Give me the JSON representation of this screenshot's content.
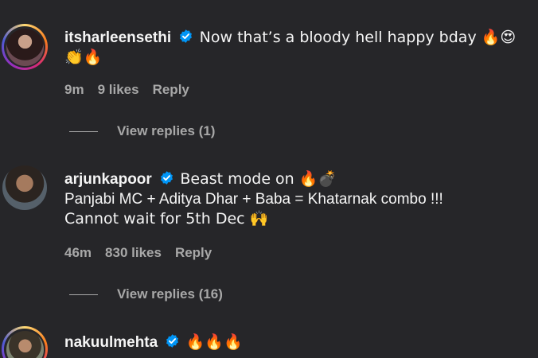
{
  "comments": [
    {
      "username": "itsharleensethi",
      "line1": "Now that’s a bloody hell happy bday 🔥😍",
      "line2": "👏🔥",
      "time": "9m",
      "likes": "9 likes",
      "reply": "Reply",
      "view_replies": "View replies (1)"
    },
    {
      "username": "arjunkapoor",
      "line1": "Beast mode on 🔥💣",
      "line2": "Panjabi MC + Aditya Dhar + Baba = Khatarnak combo !!!",
      "line3": "Cannot wait for 5th Dec 🙌",
      "time": "46m",
      "likes": "830 likes",
      "reply": "Reply",
      "view_replies": "View replies (16)"
    },
    {
      "username": "nakuulmehta",
      "line1": "🔥🔥🔥"
    }
  ],
  "colors": {
    "background": "#262629",
    "text": "#f5f5f5",
    "muted": "#a8a8a8",
    "verified": "#0095f6"
  }
}
